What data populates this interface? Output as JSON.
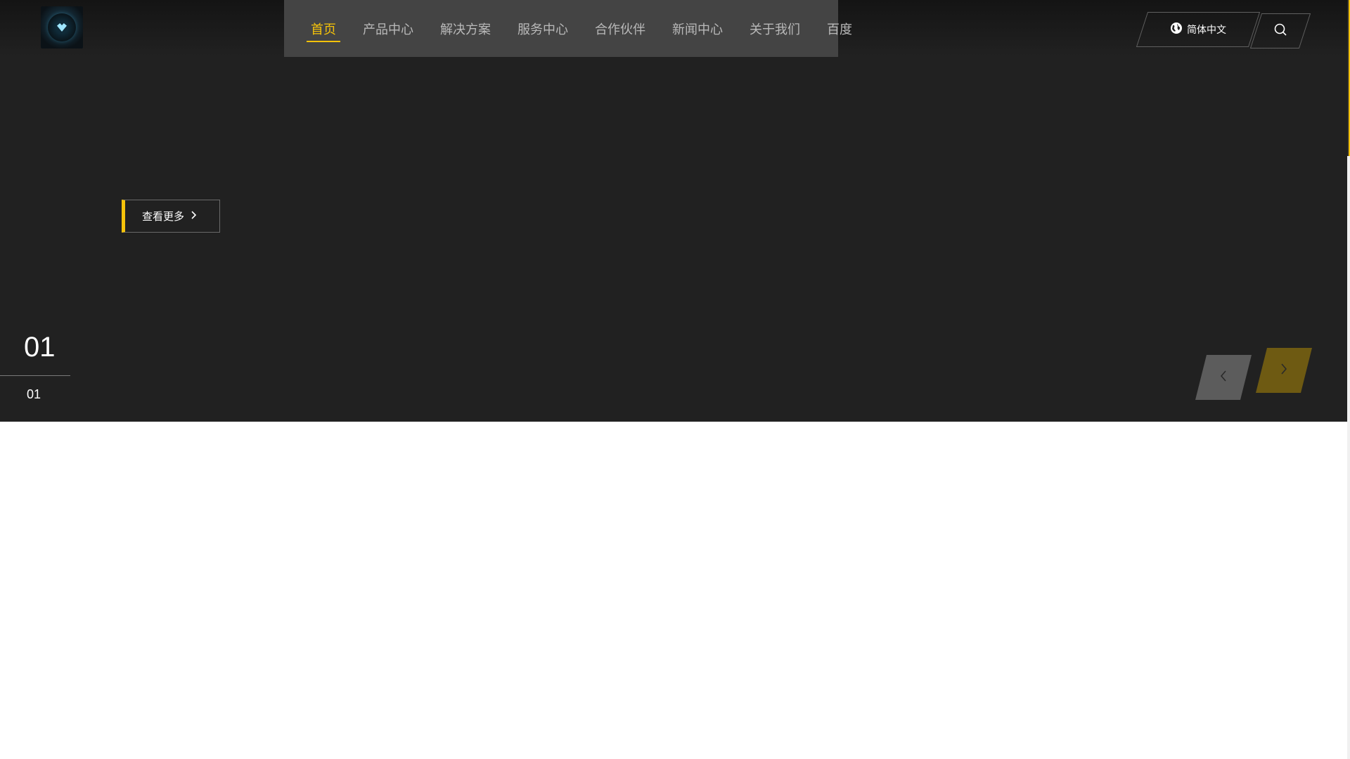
{
  "brand": {
    "logo_icon": "gem-logo-icon"
  },
  "nav": {
    "items": [
      {
        "label": "首页",
        "active": true
      },
      {
        "label": "产品中心",
        "active": false
      },
      {
        "label": "解决方案",
        "active": false
      },
      {
        "label": "服务中心",
        "active": false
      },
      {
        "label": "合作伙伴",
        "active": false
      },
      {
        "label": "新闻中心",
        "active": false
      },
      {
        "label": "关于我们",
        "active": false
      },
      {
        "label": "百度",
        "active": false
      }
    ]
  },
  "header": {
    "language_label": "简体中文",
    "language_icon": "globe-icon",
    "search_icon": "search-icon"
  },
  "hero": {
    "more_label": "查看更多",
    "more_icon": "chevron-right-icon",
    "slide_current": "01",
    "slide_total": "01",
    "prev_icon": "chevron-left-icon",
    "next_icon": "chevron-right-icon"
  },
  "colors": {
    "hero_bg": "#212121",
    "nav_bg": "#444444",
    "accent": "#f5c20a",
    "nav_text": "#b9b9b9"
  }
}
